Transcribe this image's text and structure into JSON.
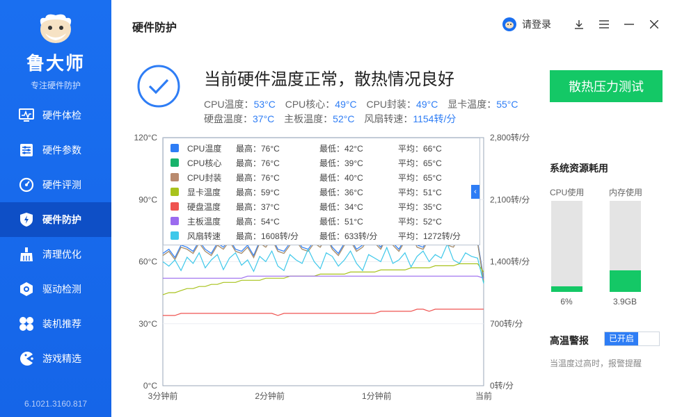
{
  "sidebar": {
    "brand": "鲁大师",
    "tagline": "专注硬件防护",
    "items": [
      {
        "label": "硬件体检",
        "icon": "monitor-icon"
      },
      {
        "label": "硬件参数",
        "icon": "sliders-icon"
      },
      {
        "label": "硬件评测",
        "icon": "gauge-icon"
      },
      {
        "label": "硬件防护",
        "icon": "shield-icon",
        "active": true
      },
      {
        "label": "清理优化",
        "icon": "broom-icon"
      },
      {
        "label": "驱动检测",
        "icon": "gear-icon"
      },
      {
        "label": "装机推荐",
        "icon": "grid-icon"
      },
      {
        "label": "游戏精选",
        "icon": "pacman-icon"
      }
    ],
    "version": "6.1021.3160.817"
  },
  "header": {
    "title": "硬件防护",
    "login": "请登录"
  },
  "status": {
    "title": "当前硬件温度正常，散热情况良好",
    "readings_row1": [
      {
        "label": "CPU温度：",
        "value": "53°C"
      },
      {
        "label": "CPU核心：",
        "value": "49°C"
      },
      {
        "label": "CPU封装：",
        "value": "49°C"
      },
      {
        "label": "显卡温度：",
        "value": "55°C"
      }
    ],
    "readings_row2": [
      {
        "label": "硬盘温度：",
        "value": "37°C"
      },
      {
        "label": "主板温度：",
        "value": "52°C"
      },
      {
        "label": "风扇转速：",
        "value": "1154转/分"
      }
    ],
    "stress_button": "散热压力测试"
  },
  "legend": [
    {
      "name": "CPU温度",
      "max": "最高：76°C",
      "min": "最低：42°C",
      "avg": "平均：66°C",
      "color": "#2e7df5"
    },
    {
      "name": "CPU核心",
      "max": "最高：76°C",
      "min": "最低：39°C",
      "avg": "平均：65°C",
      "color": "#18b36b"
    },
    {
      "name": "CPU封装",
      "max": "最高：76°C",
      "min": "最低：40°C",
      "avg": "平均：65°C",
      "color": "#b98a6e"
    },
    {
      "name": "显卡温度",
      "max": "最高：59°C",
      "min": "最低：36°C",
      "avg": "平均：51°C",
      "color": "#a8c21c"
    },
    {
      "name": "硬盘温度",
      "max": "最高：37°C",
      "min": "最低：34°C",
      "avg": "平均：35°C",
      "color": "#ef5350"
    },
    {
      "name": "主板温度",
      "max": "最高：54°C",
      "min": "最低：51°C",
      "avg": "平均：52°C",
      "color": "#9b6bef"
    },
    {
      "name": "风扇转速",
      "max": "最高：1608转/分",
      "min": "最低：633转/分",
      "avg": "平均：1272转/分",
      "color": "#3fc8ea"
    }
  ],
  "chart_data": {
    "type": "line",
    "x": [
      "3分钟前",
      "2分钟前",
      "1分钟前",
      "当前"
    ],
    "y_left_ticks": [
      "0°C",
      "30°C",
      "60°C",
      "90°C",
      "120°C"
    ],
    "y_left_range": [
      0,
      120
    ],
    "y_right_ticks": [
      "0转/分",
      "700转/分",
      "1,400转/分",
      "2,100转/分",
      "2,800转/分"
    ],
    "y_right_range": [
      0,
      2800
    ],
    "series": [
      {
        "name": "CPU温度",
        "values": [
          64,
          66,
          62,
          68,
          67,
          65,
          70,
          66,
          64,
          69,
          67,
          71,
          66,
          65,
          68,
          63,
          70,
          68,
          72,
          66,
          65,
          69,
          71,
          67,
          66,
          70,
          68,
          73,
          67,
          64,
          69,
          71,
          66,
          68,
          72,
          70,
          67,
          73,
          69,
          66,
          71,
          74,
          68,
          67,
          72,
          70,
          75,
          69,
          68,
          73,
          71,
          74,
          70,
          52
        ]
      },
      {
        "name": "CPU核心",
        "values": [
          63,
          65,
          61,
          67,
          66,
          64,
          69,
          65,
          63,
          68,
          66,
          70,
          65,
          64,
          67,
          62,
          69,
          67,
          71,
          65,
          64,
          68,
          70,
          66,
          65,
          69,
          67,
          72,
          66,
          63,
          68,
          70,
          65,
          67,
          71,
          69,
          66,
          72,
          68,
          65,
          70,
          73,
          67,
          66,
          71,
          69,
          74,
          68,
          67,
          72,
          70,
          73,
          69,
          50
        ]
      },
      {
        "name": "CPU封装",
        "values": [
          63,
          65,
          61,
          67,
          66,
          64,
          69,
          65,
          63,
          68,
          66,
          70,
          65,
          64,
          67,
          62,
          69,
          67,
          71,
          65,
          64,
          68,
          70,
          66,
          65,
          69,
          67,
          72,
          66,
          63,
          68,
          70,
          65,
          67,
          71,
          69,
          66,
          72,
          68,
          65,
          70,
          73,
          67,
          66,
          71,
          69,
          74,
          68,
          67,
          72,
          70,
          73,
          69,
          51
        ]
      },
      {
        "name": "显卡温度",
        "values": [
          44,
          45,
          45,
          46,
          47,
          47,
          48,
          48,
          49,
          49,
          50,
          50,
          50,
          51,
          51,
          51,
          51,
          52,
          52,
          52,
          52,
          53,
          53,
          53,
          53,
          53,
          54,
          54,
          54,
          54,
          54,
          55,
          55,
          55,
          55,
          55,
          56,
          56,
          56,
          56,
          56,
          57,
          57,
          57,
          57,
          58,
          58,
          58,
          58,
          59,
          59,
          59,
          59,
          55
        ]
      },
      {
        "name": "硬盘温度",
        "values": [
          34,
          34,
          34,
          35,
          35,
          35,
          35,
          35,
          35,
          35,
          35,
          35,
          35,
          35,
          35,
          35,
          35,
          35,
          35,
          34,
          35,
          35,
          35,
          35,
          35,
          35,
          35,
          35,
          35,
          35,
          35,
          35,
          35,
          35,
          35,
          35,
          36,
          36,
          36,
          36,
          36,
          36,
          37,
          37,
          36,
          37,
          37,
          37,
          37,
          37,
          37,
          37,
          37,
          37
        ]
      },
      {
        "name": "主板温度",
        "values": [
          52,
          52,
          52,
          52,
          52,
          52,
          52,
          52,
          52,
          52,
          52,
          52,
          52,
          52,
          53,
          53,
          53,
          53,
          53,
          53,
          53,
          53,
          53,
          53,
          53,
          53,
          53,
          53,
          53,
          53,
          53,
          53,
          53,
          53,
          53,
          53,
          53,
          53,
          53,
          53,
          53,
          53,
          53,
          53,
          53,
          53,
          53,
          53,
          53,
          53,
          53,
          53,
          53,
          52
        ]
      },
      {
        "name": "风扇转速",
        "values": [
          1400,
          1350,
          1420,
          1300,
          1450,
          1380,
          1500,
          1330,
          1420,
          1480,
          1310,
          1440,
          1500,
          1360,
          1420,
          1290,
          1460,
          1400,
          1520,
          1350,
          1300,
          1480,
          1420,
          1380,
          1540,
          1400,
          1320,
          1500,
          1460,
          1350,
          1420,
          1520,
          1380,
          1300,
          1480,
          1440,
          1400,
          1560,
          1380,
          1420,
          1500,
          1340,
          1460,
          1520,
          1400,
          1480,
          1440,
          1600,
          1420,
          1380,
          1500,
          1460,
          1440,
          1154
        ]
      }
    ]
  },
  "resources": {
    "title": "系统资源耗用",
    "cpu_label": "CPU使用",
    "cpu_value": "6%",
    "cpu_fraction": 0.06,
    "mem_label": "内存使用",
    "mem_value": "3.9GB",
    "mem_fraction": 0.24
  },
  "alarm": {
    "title": "高温警报",
    "toggle": "已开启",
    "desc": "当温度过高时，报警提醒"
  }
}
